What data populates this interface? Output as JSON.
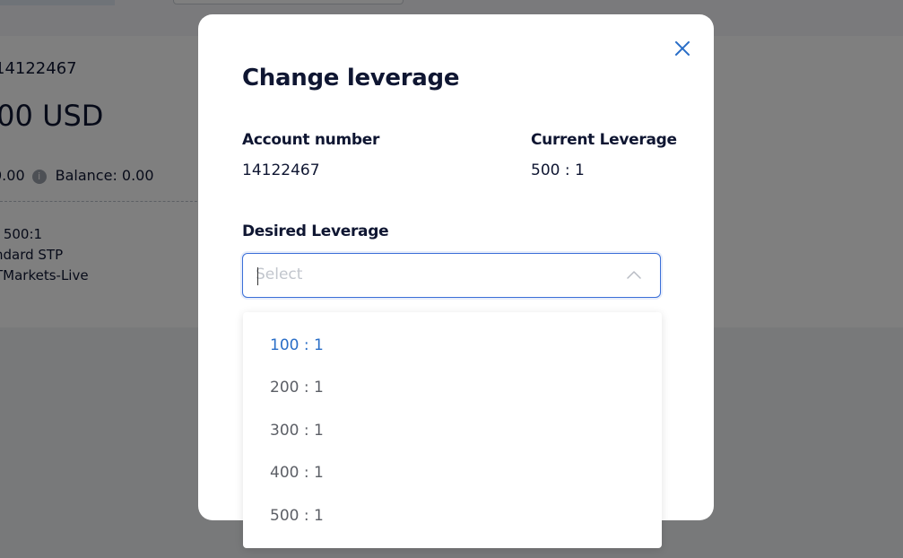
{
  "background": {
    "account_number": "14122467",
    "balance_amount": ".00 USD",
    "equity_text": "0.00",
    "balance_label": "Balance: 0.00",
    "leverage_line": ": 500:1",
    "account_type_line": "ndard STP",
    "server_line": "TMarkets-Live"
  },
  "modal": {
    "title": "Change leverage",
    "account_number_label": "Account number",
    "account_number_value": "14122467",
    "current_leverage_label": "Current Leverage",
    "current_leverage_value": "500 : 1",
    "desired_leverage_label": "Desired Leverage",
    "select_placeholder": "Select"
  },
  "dropdown": {
    "options": [
      "100 : 1",
      "200 : 1",
      "300 : 1",
      "400 : 1",
      "500 : 1"
    ],
    "highlighted_index": 0
  },
  "colors": {
    "accent": "#2a6ec7",
    "focus_border": "#3b6fd8",
    "text_dark": "#0f1632"
  },
  "icons": {
    "close": "close-icon",
    "chevron": "chevron-up-icon",
    "info": "info-icon"
  }
}
